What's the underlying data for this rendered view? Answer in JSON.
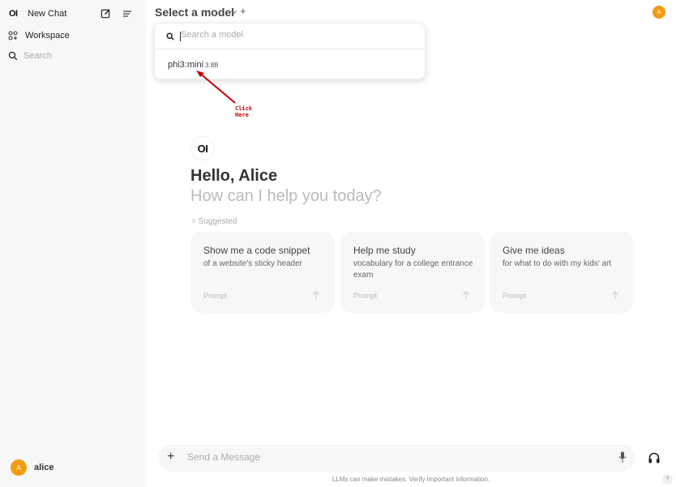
{
  "sidebar": {
    "logo": "OI",
    "new_chat_label": "New Chat",
    "workspace_label": "Workspace",
    "search_label": "Search",
    "user": {
      "initial": "A",
      "name": "alice"
    }
  },
  "topbar": {
    "model_selector_label": "Select a model",
    "avatar_initial": "A"
  },
  "model_dropdown": {
    "search_placeholder": "Search a model",
    "search_value": "",
    "items": [
      {
        "name": "phi3:mini",
        "size": "3.8B"
      }
    ]
  },
  "annotation": {
    "line1": "Click",
    "line2": "Here",
    "color": "#c00000"
  },
  "main": {
    "logo": "OI",
    "greeting": "Hello, Alice",
    "subheading": "How can I help you today?",
    "suggested_label": "Suggested",
    "suggestions": [
      {
        "title": "Show me a code snippet",
        "subtitle": "of a website's sticky header",
        "tag": "Prompt"
      },
      {
        "title": "Help me study",
        "subtitle": "vocabulary for a college entrance exam",
        "tag": "Prompt"
      },
      {
        "title": "Give me ideas",
        "subtitle": "for what to do with my kids' art",
        "tag": "Prompt"
      }
    ]
  },
  "composer": {
    "placeholder": "Send a Message",
    "value": "",
    "disclaimer": "LLMs can make mistakes. Verify important information.",
    "help_label": "?"
  },
  "colors": {
    "accent": "#f39c12",
    "sidebar_bg": "#f7f7f7"
  }
}
